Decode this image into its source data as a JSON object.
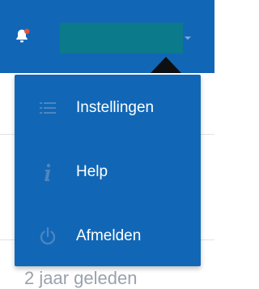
{
  "header": {
    "notification_icon": "bell-icon",
    "user_menu_chevron_icon": "chevron-down-icon"
  },
  "menu": {
    "items": [
      {
        "label": "Instellingen",
        "icon": "list-icon"
      },
      {
        "label": "Help",
        "icon": "info-icon"
      },
      {
        "label": "Afmelden",
        "icon": "power-icon"
      }
    ]
  },
  "background": {
    "timestamp": "2 jaar geleden"
  },
  "colors": {
    "primary": "#1167b6",
    "user_area": "#0b7a8a",
    "icon_muted": "#4f86c0",
    "notification_dot": "#e5533d"
  }
}
